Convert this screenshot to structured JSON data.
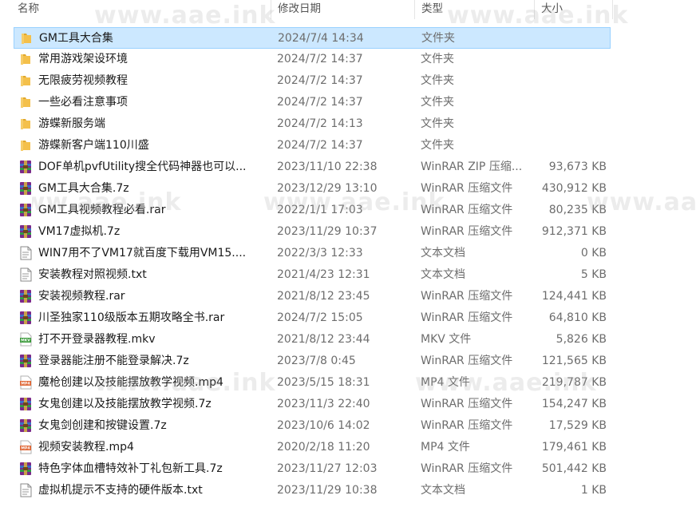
{
  "columns": {
    "name": "名称",
    "date": "修改日期",
    "type": "类型",
    "size": "大小"
  },
  "watermark": "www.aae.ink",
  "watermark_partial": "www.aae.ir",
  "colors": {
    "selected_bg": "#cce8ff",
    "selected_border": "#99d1ff",
    "folder": "#f4c04b",
    "winrar": "#7a2a8a",
    "mp4": "#e06a3a",
    "mkv": "#3a9a3a"
  },
  "files": [
    {
      "name": "GM工具大合集",
      "date": "2024/7/4 14:34",
      "type": "文件夹",
      "size": "",
      "icon": "folder-icon",
      "selected": true
    },
    {
      "name": "常用游戏架设环境",
      "date": "2024/7/2 14:37",
      "type": "文件夹",
      "size": "",
      "icon": "folder-icon"
    },
    {
      "name": "无限疲劳视频教程",
      "date": "2024/7/2 14:37",
      "type": "文件夹",
      "size": "",
      "icon": "folder-icon"
    },
    {
      "name": "一些必看注意事项",
      "date": "2024/7/2 14:37",
      "type": "文件夹",
      "size": "",
      "icon": "folder-icon"
    },
    {
      "name": "游蝶新服务端",
      "date": "2024/7/2 14:13",
      "type": "文件夹",
      "size": "",
      "icon": "folder-icon"
    },
    {
      "name": "游蝶新客户端110川盛",
      "date": "2024/7/2 14:37",
      "type": "文件夹",
      "size": "",
      "icon": "folder-icon"
    },
    {
      "name": "DOF单机pvfUtility搜全代码神器也可以...",
      "date": "2023/11/10 22:38",
      "type": "WinRAR ZIP 压缩...",
      "size": "93,673 KB",
      "icon": "winrar-icon"
    },
    {
      "name": "GM工具大合集.7z",
      "date": "2023/12/29 13:10",
      "type": "WinRAR 压缩文件",
      "size": "430,912 KB",
      "icon": "winrar-icon"
    },
    {
      "name": "GM工具视频教程必看.rar",
      "date": "2022/1/1 17:03",
      "type": "WinRAR 压缩文件",
      "size": "80,235 KB",
      "icon": "winrar-icon"
    },
    {
      "name": "VM17虚拟机.7z",
      "date": "2023/11/29 10:37",
      "type": "WinRAR 压缩文件",
      "size": "912,371 KB",
      "icon": "winrar-icon"
    },
    {
      "name": "WIN7用不了VM17就百度下载用VM15....",
      "date": "2022/3/3 12:33",
      "type": "文本文档",
      "size": "0 KB",
      "icon": "text-file-icon"
    },
    {
      "name": "安装教程对照视频.txt",
      "date": "2021/4/23 12:31",
      "type": "文本文档",
      "size": "5 KB",
      "icon": "text-file-icon"
    },
    {
      "name": "安装视频教程.rar",
      "date": "2021/8/12 23:45",
      "type": "WinRAR 压缩文件",
      "size": "124,441 KB",
      "icon": "winrar-icon"
    },
    {
      "name": "川圣独家110级版本五期攻略全书.rar",
      "date": "2024/7/2 15:05",
      "type": "WinRAR 压缩文件",
      "size": "64,810 KB",
      "icon": "winrar-icon"
    },
    {
      "name": "打不开登录器教程.mkv",
      "date": "2021/8/12 23:44",
      "type": "MKV 文件",
      "size": "5,826 KB",
      "icon": "mkv-icon"
    },
    {
      "name": "登录器能注册不能登录解决.7z",
      "date": "2023/7/8 0:45",
      "type": "WinRAR 压缩文件",
      "size": "121,565 KB",
      "icon": "winrar-icon"
    },
    {
      "name": "魔枪创建以及技能摆放教学视频.mp4",
      "date": "2023/5/15 18:31",
      "type": "MP4 文件",
      "size": "219,787 KB",
      "icon": "mp4-icon"
    },
    {
      "name": "女鬼创建以及技能摆放教学视频.7z",
      "date": "2023/11/3 22:40",
      "type": "WinRAR 压缩文件",
      "size": "154,247 KB",
      "icon": "winrar-icon"
    },
    {
      "name": "女鬼剑创建和按键设置.7z",
      "date": "2023/10/6 14:02",
      "type": "WinRAR 压缩文件",
      "size": "17,529 KB",
      "icon": "winrar-icon"
    },
    {
      "name": "视频安装教程.mp4",
      "date": "2020/2/18 11:20",
      "type": "MP4 文件",
      "size": "179,461 KB",
      "icon": "mp4-icon"
    },
    {
      "name": "特色字体血槽特效补丁礼包新工具.7z",
      "date": "2023/11/27 12:03",
      "type": "WinRAR 压缩文件",
      "size": "501,442 KB",
      "icon": "winrar-icon"
    },
    {
      "name": "虚拟机提示不支持的硬件版本.txt",
      "date": "2023/11/29 10:38",
      "type": "文本文档",
      "size": "1 KB",
      "icon": "text-file-icon"
    }
  ]
}
